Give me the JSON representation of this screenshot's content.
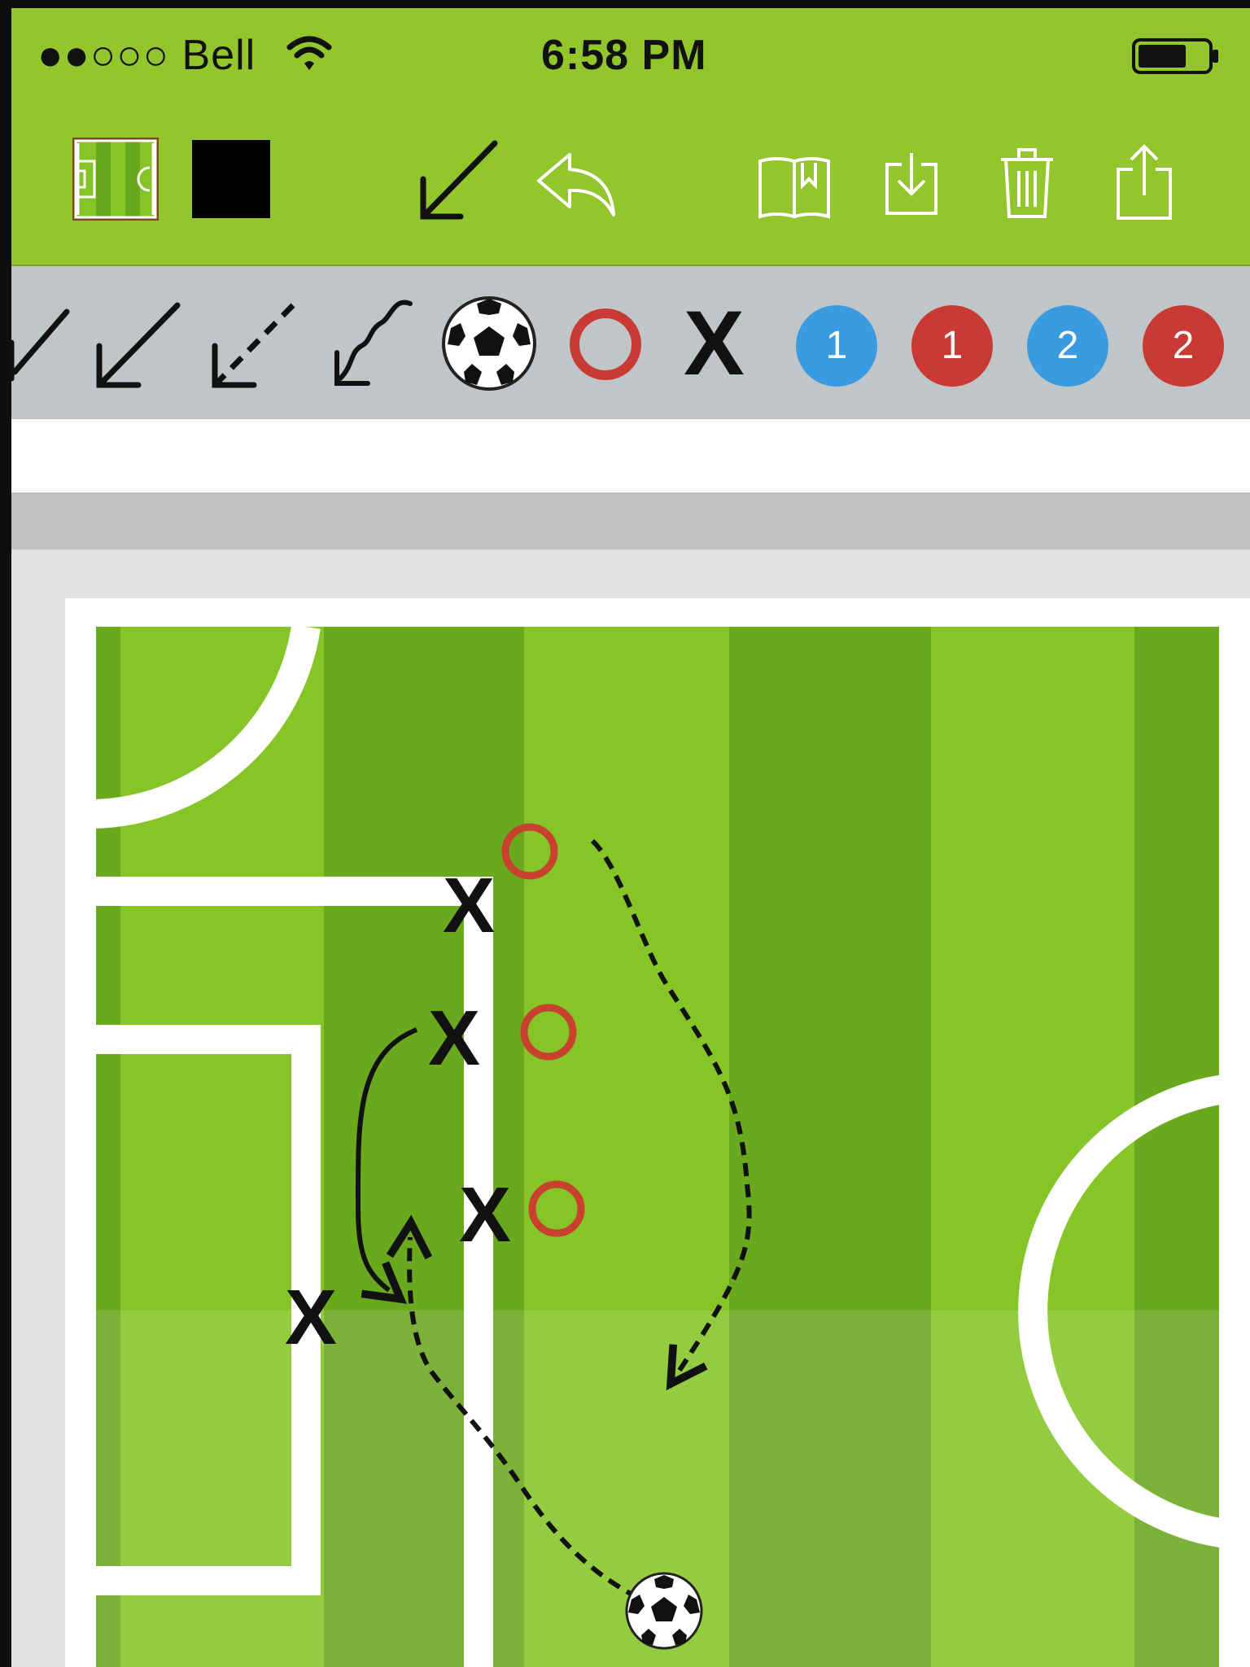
{
  "status_bar": {
    "carrier": "●●○○○ Bell",
    "time": "6:58 PM",
    "wifi_icon": "wifi-icon",
    "battery_icon": "battery-icon"
  },
  "toolbar": {
    "left_tools": [
      "field-thumbnail-icon",
      "color-swatch"
    ],
    "swatch_color": "#000000",
    "center_tools": [
      "arrow-tool-icon",
      "undo-icon"
    ],
    "right_tools": [
      "book-icon",
      "download-icon",
      "trash-icon",
      "share-icon"
    ]
  },
  "palette": {
    "items": [
      {
        "name": "partial-arrow-icon"
      },
      {
        "name": "solid-arrow-icon"
      },
      {
        "name": "dashed-arrow-icon"
      },
      {
        "name": "wavy-arrow-icon"
      },
      {
        "name": "soccer-ball-icon"
      },
      {
        "name": "red-circle-icon"
      },
      {
        "name": "x-marker-icon",
        "label": "X"
      }
    ],
    "badges": [
      {
        "label": "1",
        "color": "#3a9be0"
      },
      {
        "label": "1",
        "color": "#c83a33"
      },
      {
        "label": "2",
        "color": "#3a9be0"
      },
      {
        "label": "2",
        "color": "#c83a33"
      }
    ]
  },
  "pitch": {
    "colors": {
      "grass_light": "#86c527",
      "grass_dark": "#6aa81e",
      "lines": "#ffffff",
      "circle_marker": "#c8412f",
      "drawing": "#111111"
    },
    "x_label": "X"
  }
}
